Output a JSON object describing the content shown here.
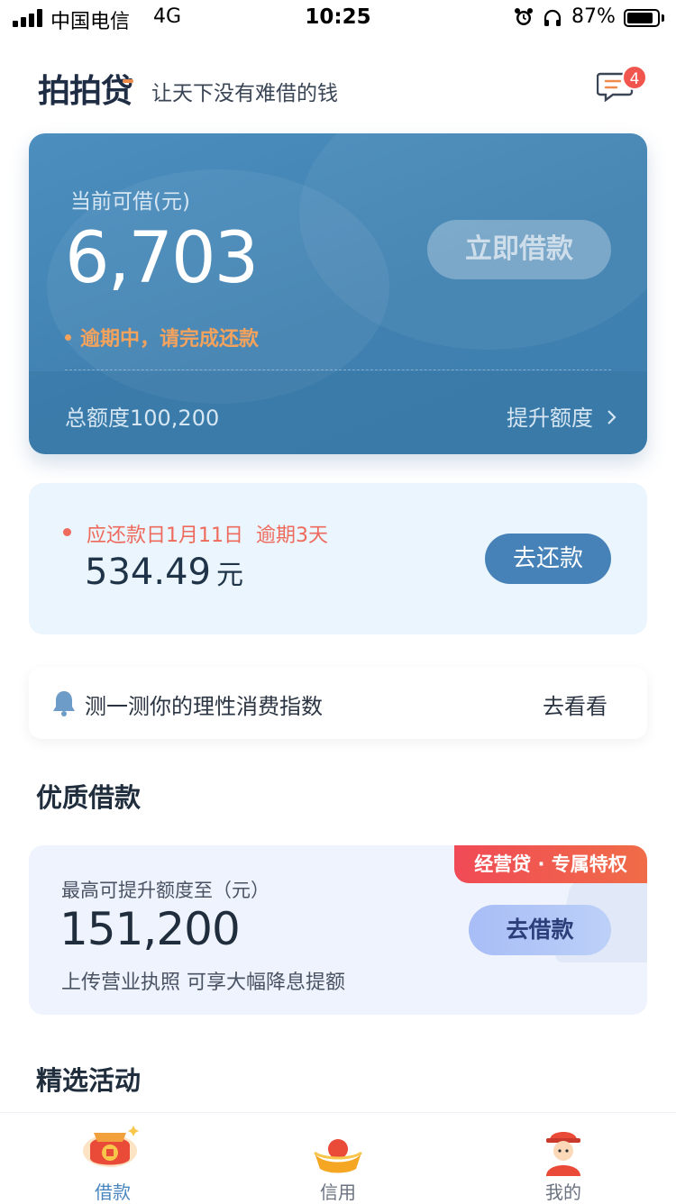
{
  "status_bar": {
    "carrier": "中国电信",
    "network": "4G",
    "time": "10:25",
    "battery": "87%",
    "battery_level": 0.87,
    "icons": [
      "signal-icon",
      "alarm-icon",
      "headphone-icon",
      "battery-icon"
    ]
  },
  "header": {
    "logo": "拍拍贷",
    "slogan": "让天下没有难借的钱",
    "message_badge": "4"
  },
  "main_card": {
    "available_label": "当前可借(元)",
    "available_amount": "6,703",
    "borrow_button": "立即借款",
    "overdue_notice": "逾期中，请完成还款",
    "total_quota": "总额度100,200",
    "raise_quota": "提升额度"
  },
  "repay_card": {
    "due_info": "应还款日1月11日  逾期3天",
    "amount": "534.49",
    "unit": "元",
    "repay_button": "去还款"
  },
  "index_row": {
    "text": "测一测你的理性消费指数",
    "link": "去看看"
  },
  "quality_section": {
    "title": "优质借款",
    "tag": "经营贷 · 专属特权",
    "label": "最高可提升额度至（元）",
    "amount": "151,200",
    "description": "上传营业执照 可享大幅降息提额",
    "button": "去借款"
  },
  "activity_section": {
    "title": "精选活动"
  },
  "tab_bar": {
    "tabs": [
      {
        "label": "借款",
        "icon": "loan-bag-icon",
        "active": true
      },
      {
        "label": "信用",
        "icon": "gold-ingot-icon",
        "active": false
      },
      {
        "label": "我的",
        "icon": "profile-avatar-icon",
        "active": false
      }
    ]
  },
  "colors": {
    "card_blue": "#4382b4",
    "accent_orange": "#f5a35c",
    "alert_red": "#ee6a5c",
    "tab_active": "#4a86bf"
  }
}
